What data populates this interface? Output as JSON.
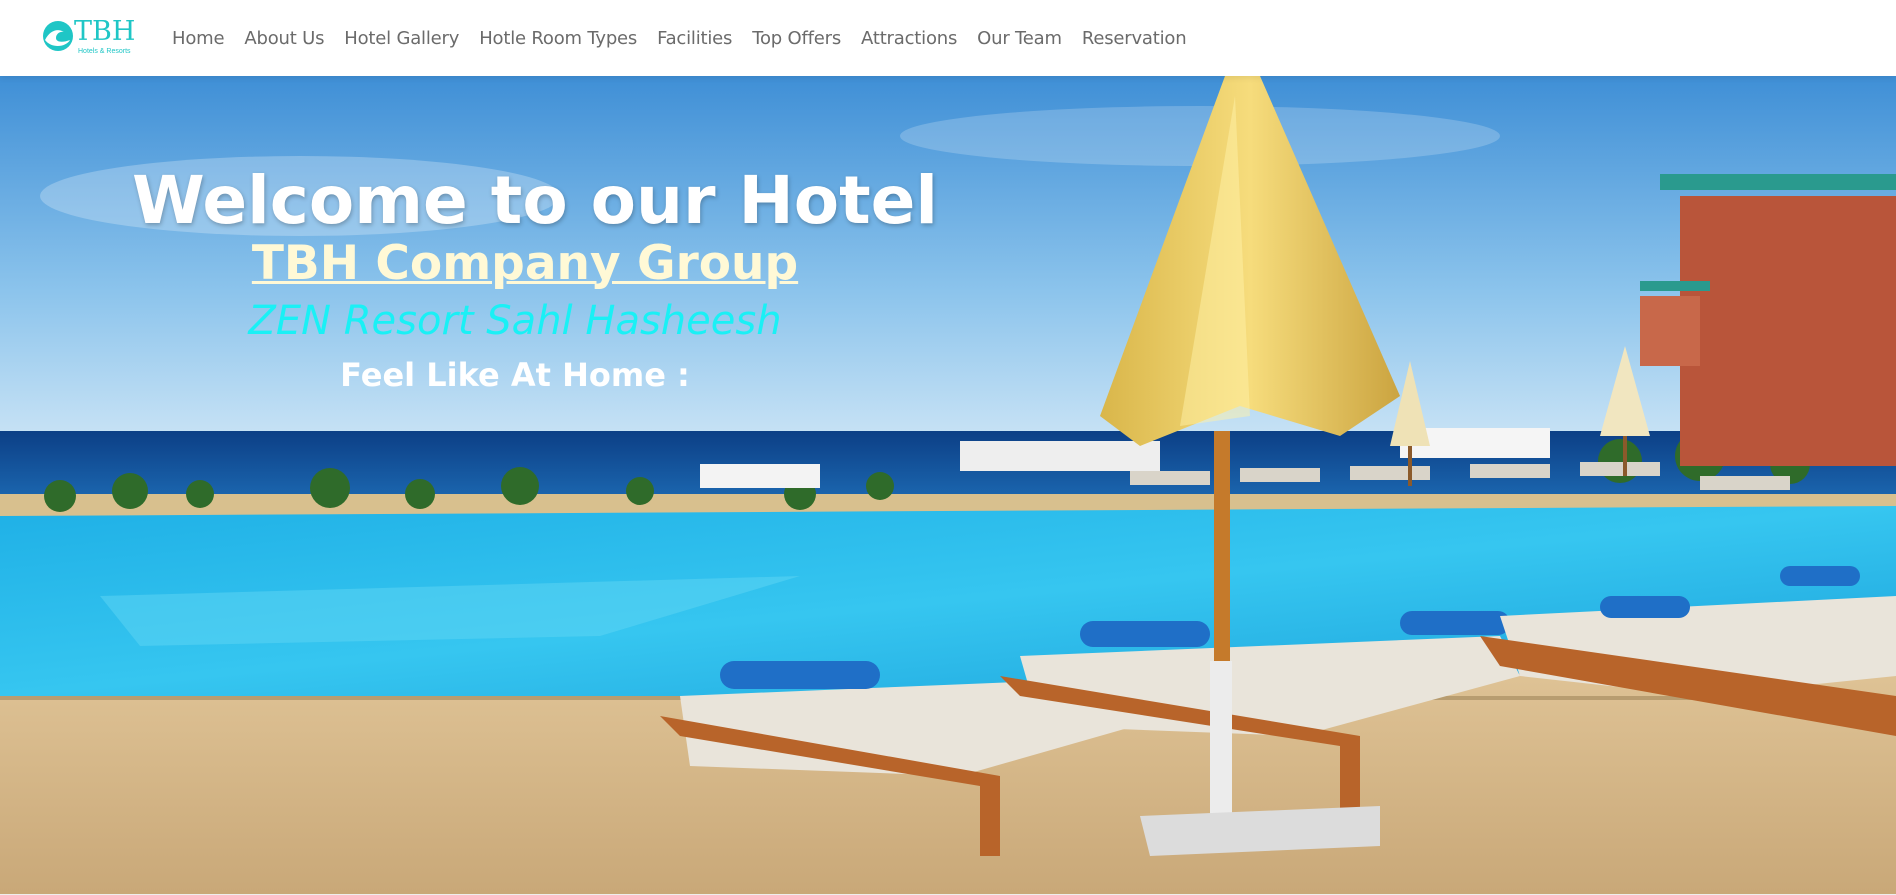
{
  "brand": {
    "logo_text": "TBH",
    "logo_subtext": "Hotels & Resorts",
    "logo_icon": "wave-icon",
    "accent_color": "#1fc6c6"
  },
  "nav": {
    "items": [
      {
        "label": "Home"
      },
      {
        "label": "About Us"
      },
      {
        "label": "Hotel Gallery"
      },
      {
        "label": "Hotle Room Types"
      },
      {
        "label": "Facilities"
      },
      {
        "label": "Top Offers"
      },
      {
        "label": "Attractions"
      },
      {
        "label": "Our Team"
      },
      {
        "label": "Reservation"
      }
    ]
  },
  "hero": {
    "welcome": "Welcome to our Hotel",
    "company": "TBH Company Group",
    "resort": "ZEN Resort Sahl Hasheesh",
    "tagline": "Feel Like At Home :"
  }
}
